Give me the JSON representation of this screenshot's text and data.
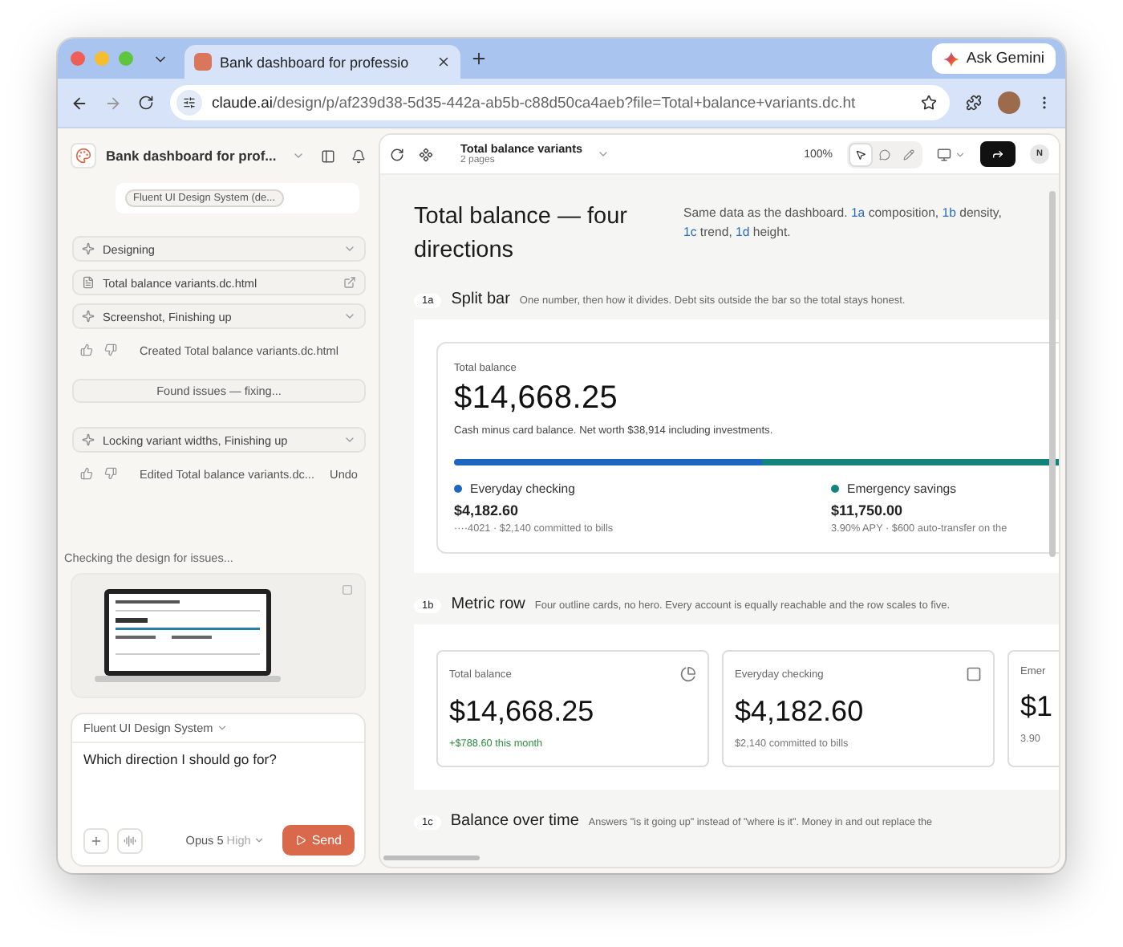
{
  "browser": {
    "tab_title": "Bank dashboard for professio",
    "url_host": "claude.ai",
    "url_path": "/design/p/af239d38-5d35-442a-ab5b-c88d50ca4aeb?file=Total+balance+variants.dc.ht",
    "gemini_button": "Ask Gemini"
  },
  "sidebar": {
    "project_title": "Bank dashboard for prof...",
    "design_system_chip": "Fluent UI Design System (de...",
    "items": [
      {
        "kind": "step",
        "label": "Designing"
      },
      {
        "kind": "file",
        "label": "Total balance variants.dc.html"
      },
      {
        "kind": "step",
        "label": "Screenshot, Finishing up"
      },
      {
        "kind": "feedback",
        "label": "Created Total balance variants.dc.html"
      },
      {
        "kind": "notice",
        "label": "Found issues — fixing..."
      },
      {
        "kind": "step",
        "label": "Locking variant widths, Finishing up"
      },
      {
        "kind": "feedback",
        "label": "Edited Total balance variants.dc...",
        "action": "Undo"
      }
    ],
    "status": "Checking the design for issues...",
    "composer": {
      "design_system": "Fluent UI Design System",
      "value": "Which direction I should go for?",
      "model": "Opus 5",
      "effort": "High",
      "send_button": "Send"
    }
  },
  "canvas_toolbar": {
    "file_name": "Total balance variants",
    "pages": "2 pages",
    "zoom": "100%",
    "tools": [
      {
        "kind": "pointer",
        "selected": true
      },
      {
        "kind": "comment",
        "selected": false
      },
      {
        "kind": "draw",
        "selected": false
      }
    ],
    "avatar": "N"
  },
  "canvas": {
    "title": "Total balance — four directions",
    "intro": [
      {
        "text": "Same data as the dashboard. "
      },
      {
        "text": "1a",
        "link": true
      },
      {
        "text": " composition, "
      },
      {
        "text": "1b",
        "link": true
      },
      {
        "text": " density, "
      },
      {
        "text": "1c",
        "link": true
      },
      {
        "text": " trend, "
      },
      {
        "text": "1d",
        "link": true
      },
      {
        "text": " height."
      }
    ],
    "sections": [
      {
        "kind": "split_bar",
        "tag": "1a",
        "title": "Split bar",
        "description": "One number, then how it divides. Debt sits outside the bar so the total stays honest.",
        "label": "Total balance",
        "amount": "$14,668.25",
        "note": "Cash minus card balance. Net worth $38,914 including investments.",
        "level": 0.48,
        "accounts": [
          {
            "name": "Everyday checking",
            "color": "#1f66c1",
            "amount": "$4,182.60",
            "detail": "····4021 · $2,140 committed to bills"
          },
          {
            "name": "Emergency savings",
            "color": "#13847c",
            "amount": "$11,750.00",
            "detail": "3.90% APY · $600 auto-transfer on the"
          }
        ]
      },
      {
        "kind": "metric_row",
        "tag": "1b",
        "title": "Metric row",
        "description": "Four outline cards, no hero. Every account is equally reachable and the row scales to five.",
        "cards": [
          {
            "label": "Total balance",
            "value": "$14,668.25",
            "note": "+$788.60 this month",
            "positive": true
          },
          {
            "label": "Everyday checking",
            "value": "$4,182.60",
            "note": "$2,140 committed to bills",
            "positive": false
          },
          {
            "label": "Emer",
            "value": "$1",
            "note": "3.90",
            "positive": false
          }
        ]
      },
      {
        "kind": "trend",
        "tag": "1c",
        "title": "Balance over time",
        "description": "Answers \"is it going up\" instead of \"where is it\". Money in and out replace the"
      }
    ]
  }
}
